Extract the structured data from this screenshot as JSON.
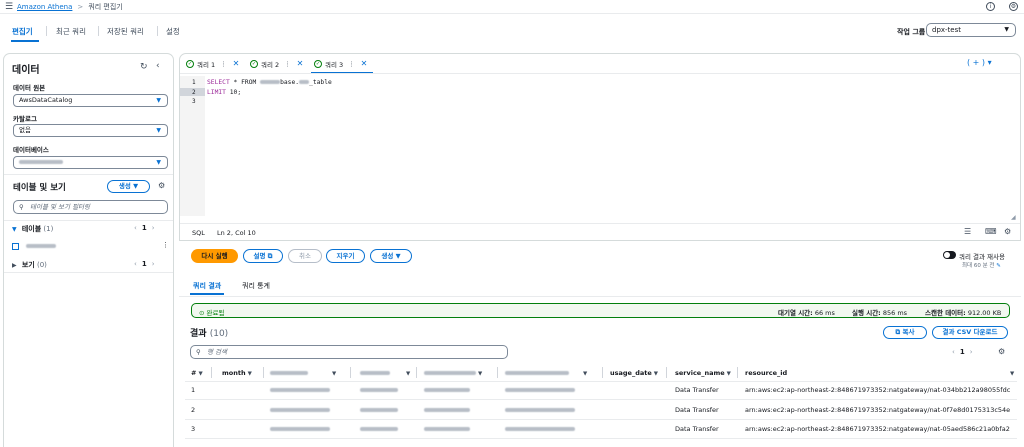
{
  "breadcrumb": {
    "root": "Amazon Athena",
    "current": "쿼리 편집기"
  },
  "main_tabs": [
    {
      "label": "편집기",
      "active": true
    },
    {
      "label": "최근 쿼리",
      "active": false
    },
    {
      "label": "저장된 쿼리",
      "active": false
    },
    {
      "label": "설정",
      "active": false
    }
  ],
  "workgroup": {
    "label": "작업 그룹",
    "value": "dpx-test"
  },
  "sidebar": {
    "title": "데이터",
    "data_source_label": "데이터 원본",
    "data_source_value": "AwsDataCatalog",
    "catalog_label": "카탈로그",
    "catalog_value": "없음",
    "database_label": "데이터베이스",
    "tables_views_title": "테이블 및 보기",
    "create_label": "생성",
    "filter_placeholder": "테이블 및 보기 필터링",
    "tables_label": "테이블",
    "tables_count": "(1)",
    "views_label": "보기",
    "views_count": "(0)",
    "page": "1"
  },
  "query_tabs": [
    {
      "label": "쿼리 1"
    },
    {
      "label": "쿼리 2"
    },
    {
      "label": "쿼리 3",
      "active": true
    }
  ],
  "editor": {
    "line_numbers": [
      "1",
      "2",
      "3"
    ],
    "line1_kw": "SELECT",
    "line1_rest": " * FROM ",
    "line1_mid": "base.",
    "line1_end": "_table",
    "line2_kw": "LIMIT",
    "line2_num": " 10;",
    "lang": "SQL",
    "cursor": "Ln 2, Col 10"
  },
  "actions": {
    "run": "다시 실행",
    "explain": "설명",
    "cancel": "취소",
    "clear": "지우기",
    "create": "생성",
    "reuse_label": "쿼리 결과 재사용",
    "reuse_sub": "최대 60 분 전"
  },
  "results": {
    "tab_results": "쿼리 결과",
    "tab_stats": "쿼리 통계",
    "status": "완료됨",
    "queue_label": "대기열 시간:",
    "queue_value": "66 ms",
    "run_label": "실행 시간:",
    "run_value": "856 ms",
    "scan_label": "스캔한 데이터:",
    "scan_value": "912.00 KB",
    "title": "결과",
    "count": "(10)",
    "copy": "복사",
    "download": "결과 CSV 다운로드",
    "search_placeholder": "행 검색",
    "page": "1",
    "columns": [
      "#",
      "month",
      "usage_date",
      "service_name",
      "resource_id"
    ],
    "rows": [
      {
        "n": "1",
        "service": "Data Transfer",
        "resource": "arn:aws:ec2:ap-northeast-2:848671973352:natgateway/nat-034bb212a98055fdc"
      },
      {
        "n": "2",
        "service": "Data Transfer",
        "resource": "arn:aws:ec2:ap-northeast-2:848671973352:natgateway/nat-0f7e8d0175313c54e"
      },
      {
        "n": "3",
        "service": "Data Transfer",
        "resource": "arn:aws:ec2:ap-northeast-2:848671973352:natgateway/nat-05aed586c21a0bfa2"
      }
    ]
  }
}
